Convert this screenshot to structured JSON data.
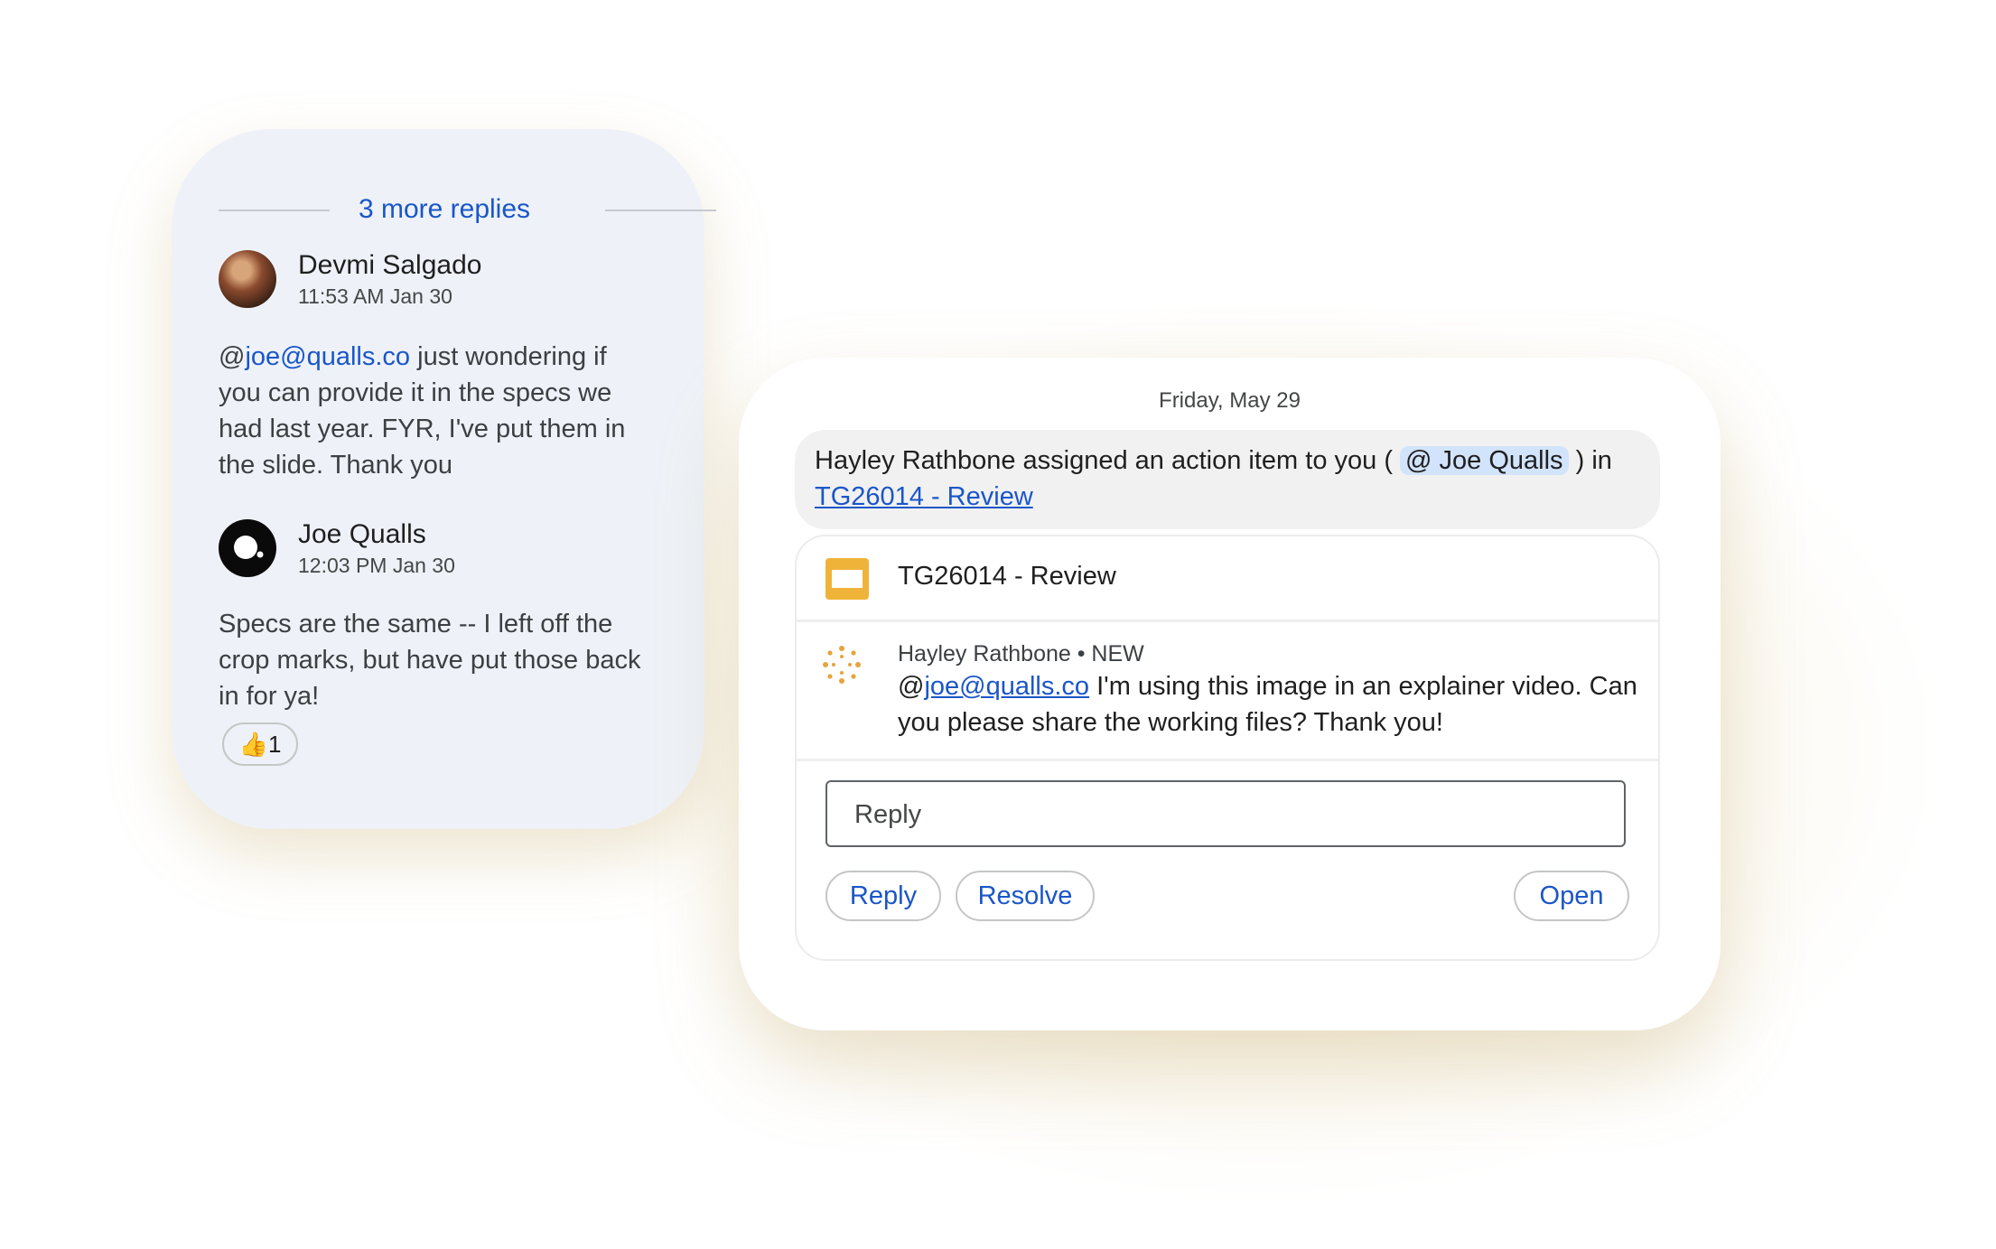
{
  "thread": {
    "more_replies": "3 more replies",
    "comments": [
      {
        "author": "Devmi Salgado",
        "timestamp": "11:53 AM Jan 30",
        "mention": "@",
        "mention_email": "joe@qualls.co",
        "text": " just wondering if you can provide it in the specs we had last year. FYR, I've put them in the slide. Thank you"
      },
      {
        "author": "Joe Qualls",
        "timestamp": "12:03 PM Jan 30",
        "text": "Specs are the same -- I left off the crop marks, but have put those back in for ya!",
        "reaction_emoji": "👍",
        "reaction_count": "1"
      }
    ]
  },
  "chat": {
    "date": "Friday, May 29",
    "notification": {
      "prefix": "Hayley Rathbone assigned an action item to you (",
      "mention": "@ Joe Qualls",
      "suffix": ") in",
      "doc_link": "TG26014 - Review"
    },
    "doc_title": "TG26014 - Review",
    "message": {
      "header": "Hayley Rathbone • NEW",
      "at": "@",
      "email": "joe@qualls.co",
      "text": " I'm using this image in an explainer video. Can you please share the working files? Thank you!"
    },
    "reply_placeholder": "Reply",
    "buttons": {
      "reply": "Reply",
      "resolve": "Resolve",
      "open": "Open"
    }
  },
  "colors": {
    "link": "#1a56c9",
    "mention_bg": "#d2e3fc",
    "slides_icon": "#f0b33a",
    "thread_bg": "#eef2f8"
  }
}
